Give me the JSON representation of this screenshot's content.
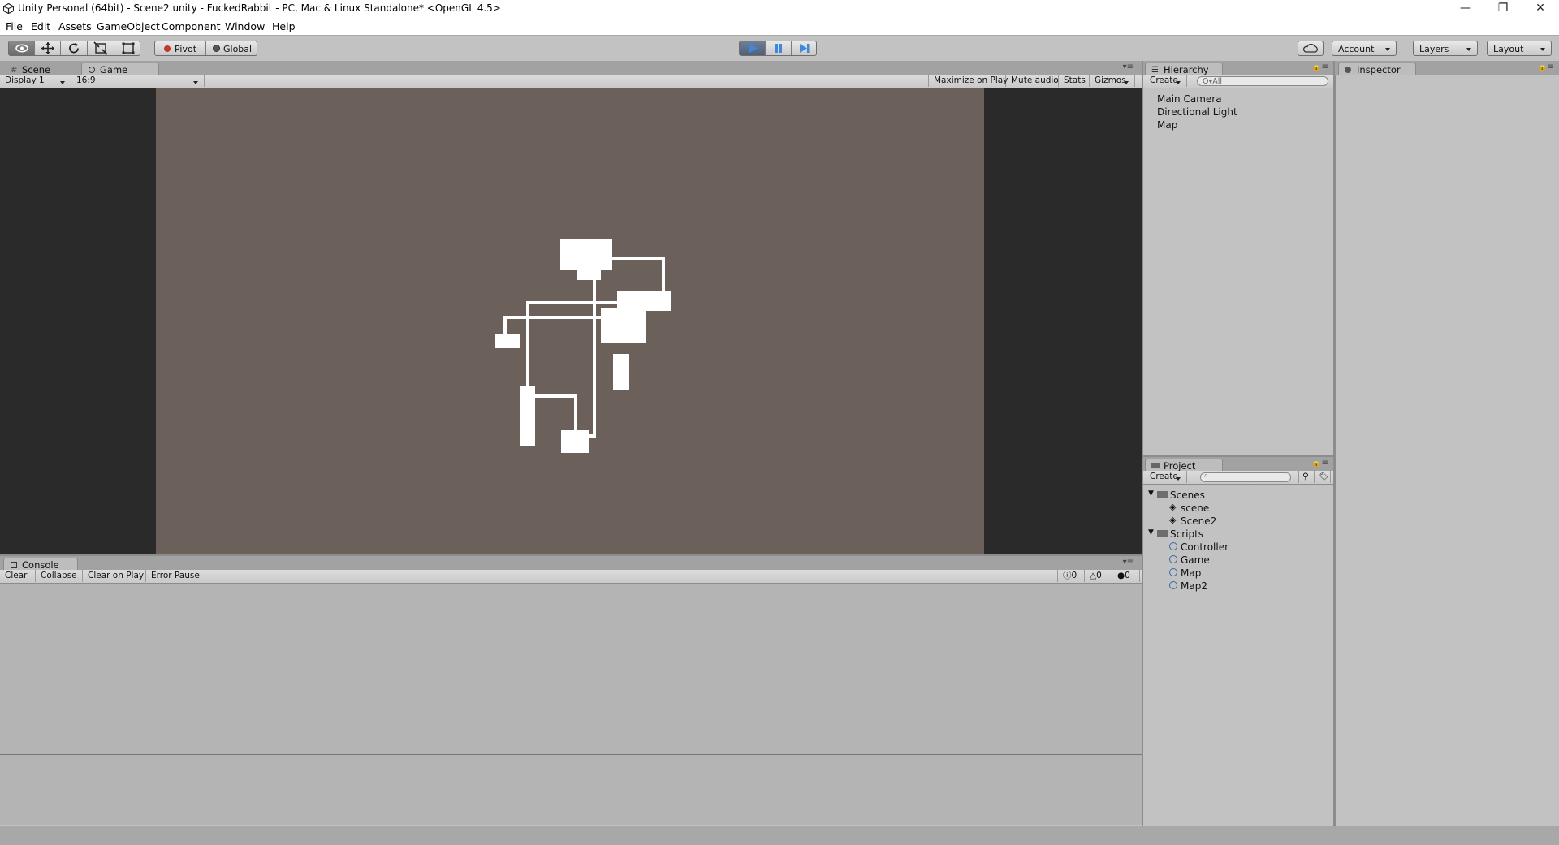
{
  "window": {
    "title": "Unity Personal (64bit) - Scene2.unity - FuckedRabbit - PC, Mac & Linux Standalone* <OpenGL 4.5>",
    "minimize": "—",
    "maximize": "❐",
    "close": "✕"
  },
  "menu": [
    "File",
    "Edit",
    "Assets",
    "GameObject",
    "Component",
    "Window",
    "Help"
  ],
  "toolbar": {
    "pivot_label": "Pivot",
    "global_label": "Global",
    "account_label": "Account",
    "layers_label": "Layers",
    "layout_label": "Layout"
  },
  "scene_panel": {
    "tabs": {
      "scene": "Scene",
      "game": "Game"
    },
    "display_select": "Display 1",
    "aspect_select": "16:9",
    "options": {
      "maximize": "Maximize on Play",
      "mute": "Mute audio",
      "stats": "Stats",
      "gizmos": "Gizmos"
    }
  },
  "hierarchy": {
    "tab": "Hierarchy",
    "create_label": "Create",
    "search_placeholder": "Q▾All",
    "items": [
      "Main Camera",
      "Directional Light",
      "Map"
    ]
  },
  "inspector": {
    "tab": "Inspector"
  },
  "project": {
    "tab": "Project",
    "create_label": "Create",
    "folders": [
      {
        "name": "Scenes",
        "children": [
          "scene",
          "Scene2"
        ]
      },
      {
        "name": "Scripts",
        "children": [
          "Controller",
          "Game",
          "Map",
          "Map2"
        ]
      }
    ]
  },
  "console": {
    "tab": "Console",
    "buttons": {
      "clear": "Clear",
      "collapse": "Collapse",
      "clear_on_play": "Clear on Play",
      "error_pause": "Error Pause"
    },
    "counts": {
      "info": "0",
      "warnings": "0",
      "errors": "0"
    }
  },
  "colors": {
    "game_bg": "#6b615a",
    "letterbox": "#2a2a2a",
    "play_active": "#3f87d8",
    "panel_bg": "#c2c2c2"
  }
}
